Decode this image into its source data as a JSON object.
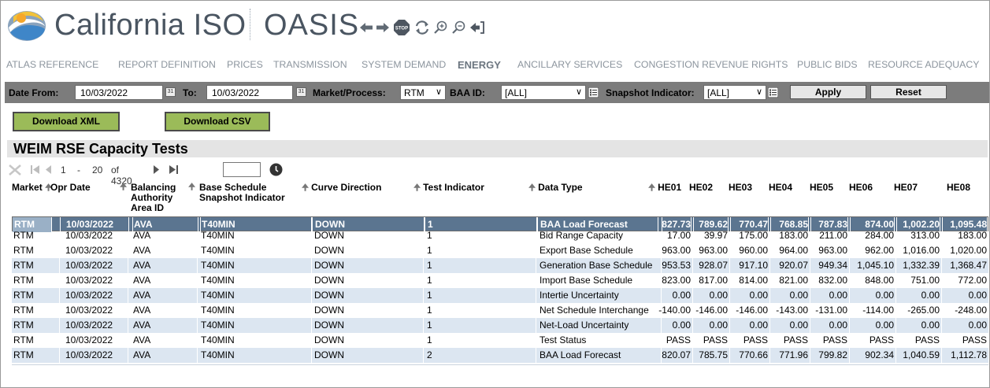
{
  "header": {
    "brand": "California ISO",
    "app": "OASIS",
    "nav_icons": [
      "back-arrow-icon",
      "forward-arrow-icon",
      "stop-icon",
      "refresh-icon",
      "zoom-in-icon",
      "zoom-out-icon",
      "logout-icon"
    ],
    "stop_label": "STOP"
  },
  "menu": [
    {
      "label": "ATLAS REFERENCE",
      "active": false
    },
    {
      "label": "REPORT DEFINITION",
      "active": false
    },
    {
      "label": "PRICES",
      "active": false
    },
    {
      "label": "TRANSMISSION",
      "active": false
    },
    {
      "label": "SYSTEM DEMAND",
      "active": false
    },
    {
      "label": "ENERGY",
      "active": true
    },
    {
      "label": "ANCILLARY SERVICES",
      "active": false
    },
    {
      "label": "CONGESTION REVENUE RIGHTS",
      "active": false
    },
    {
      "label": "PUBLIC BIDS",
      "active": false
    },
    {
      "label": "RESOURCE ADEQUACY",
      "active": false
    }
  ],
  "filters": {
    "date_from_label": "Date From:",
    "date_from_value": "10/03/2022",
    "to_label": "To:",
    "to_value": "10/03/2022",
    "market_label": "Market/Process:",
    "market_value": "RTM",
    "baa_label": "BAA ID:",
    "baa_value": "[ALL]",
    "snapshot_label": "Snapshot Indicator:",
    "snapshot_value": "[ALL]",
    "apply_label": "Apply",
    "reset_label": "Reset"
  },
  "downloads": {
    "xml_label": "Download XML",
    "csv_label": "Download CSV"
  },
  "report": {
    "title": "WEIM RSE Capacity Tests"
  },
  "pager": {
    "range_start": "1",
    "range_sep": "-",
    "range_end": "20",
    "of_total": "of 4320",
    "page_input": ""
  },
  "table": {
    "headers": {
      "market": "Market",
      "opr_date": "Opr Date",
      "baa_line1": "Balancing",
      "baa_line2": "Authority",
      "baa_line3": "Area ID",
      "bss_line1": "Base Schedule",
      "bss_line2": "Snapshot Indicator",
      "curve": "Curve Direction",
      "test_ind": "Test Indicator",
      "data_type": "Data Type",
      "he01": "HE01",
      "he02": "HE02",
      "he03": "HE03",
      "he04": "HE04",
      "he05": "HE05",
      "he06": "HE06",
      "he07": "HE07",
      "he08": "HE08"
    },
    "rows": [
      {
        "market": "RTM",
        "date": "10/03/2022",
        "baa": "AVA",
        "bss": "T40MIN",
        "curve": "DOWN",
        "test": "1",
        "type": "BAA Load Forecast",
        "v": [
          "827.73",
          "789.62",
          "770.47",
          "768.85",
          "787.83",
          "874.00",
          "1,002.20",
          "1,095.48"
        ],
        "style": "selected"
      },
      {
        "market": "RTM",
        "date": "10/03/2022",
        "baa": "AVA",
        "bss": "T40MIN",
        "curve": "DOWN",
        "test": "1",
        "type": "Bid Range Capacity",
        "v": [
          "17.00",
          "39.97",
          "175.00",
          "183.00",
          "211.00",
          "284.00",
          "313.00",
          "183.00"
        ],
        "style": "plain"
      },
      {
        "market": "RTM",
        "date": "10/03/2022",
        "baa": "AVA",
        "bss": "T40MIN",
        "curve": "DOWN",
        "test": "1",
        "type": "Export Base Schedule",
        "v": [
          "963.00",
          "963.00",
          "960.00",
          "964.00",
          "963.00",
          "962.00",
          "1,016.00",
          "1,020.00"
        ],
        "style": "plain"
      },
      {
        "market": "RTM",
        "date": "10/03/2022",
        "baa": "AVA",
        "bss": "T40MIN",
        "curve": "DOWN",
        "test": "1",
        "type": "Generation Base Schedule",
        "v": [
          "953.53",
          "928.07",
          "917.10",
          "920.07",
          "949.34",
          "1,045.10",
          "1,332.39",
          "1,368.47"
        ],
        "style": "alt"
      },
      {
        "market": "RTM",
        "date": "10/03/2022",
        "baa": "AVA",
        "bss": "T40MIN",
        "curve": "DOWN",
        "test": "1",
        "type": "Import Base Schedule",
        "v": [
          "823.00",
          "817.00",
          "814.00",
          "821.00",
          "832.00",
          "848.00",
          "751.00",
          "772.00"
        ],
        "style": "plain"
      },
      {
        "market": "RTM",
        "date": "10/03/2022",
        "baa": "AVA",
        "bss": "T40MIN",
        "curve": "DOWN",
        "test": "1",
        "type": "Intertie Uncertainty",
        "v": [
          "0.00",
          "0.00",
          "0.00",
          "0.00",
          "0.00",
          "0.00",
          "0.00",
          "0.00"
        ],
        "style": "alt"
      },
      {
        "market": "RTM",
        "date": "10/03/2022",
        "baa": "AVA",
        "bss": "T40MIN",
        "curve": "DOWN",
        "test": "1",
        "type": "Net Schedule Interchange",
        "v": [
          "-140.00",
          "-146.00",
          "-146.00",
          "-143.00",
          "-131.00",
          "-114.00",
          "-265.00",
          "-248.00"
        ],
        "style": "plain"
      },
      {
        "market": "RTM",
        "date": "10/03/2022",
        "baa": "AVA",
        "bss": "T40MIN",
        "curve": "DOWN",
        "test": "1",
        "type": "Net-Load Uncertainty",
        "v": [
          "0.00",
          "0.00",
          "0.00",
          "0.00",
          "0.00",
          "0.00",
          "0.00",
          "0.00"
        ],
        "style": "alt"
      },
      {
        "market": "RTM",
        "date": "10/03/2022",
        "baa": "AVA",
        "bss": "T40MIN",
        "curve": "DOWN",
        "test": "1",
        "type": "Test Status",
        "v": [
          "PASS",
          "PASS",
          "PASS",
          "PASS",
          "PASS",
          "PASS",
          "PASS",
          "PASS"
        ],
        "style": "plain"
      },
      {
        "market": "RTM",
        "date": "10/03/2022",
        "baa": "AVA",
        "bss": "T40MIN",
        "curve": "DOWN",
        "test": "2",
        "type": "BAA Load Forecast",
        "v": [
          "820.07",
          "785.75",
          "770.66",
          "771.96",
          "799.82",
          "902.34",
          "1,040.59",
          "1,112.78"
        ],
        "style": "alt"
      }
    ]
  },
  "colors": {
    "selected_row": "#5b7590",
    "alt_row": "#dce6f1",
    "filter_bar": "#7c7c7c",
    "download_button": "#9bbb59"
  }
}
